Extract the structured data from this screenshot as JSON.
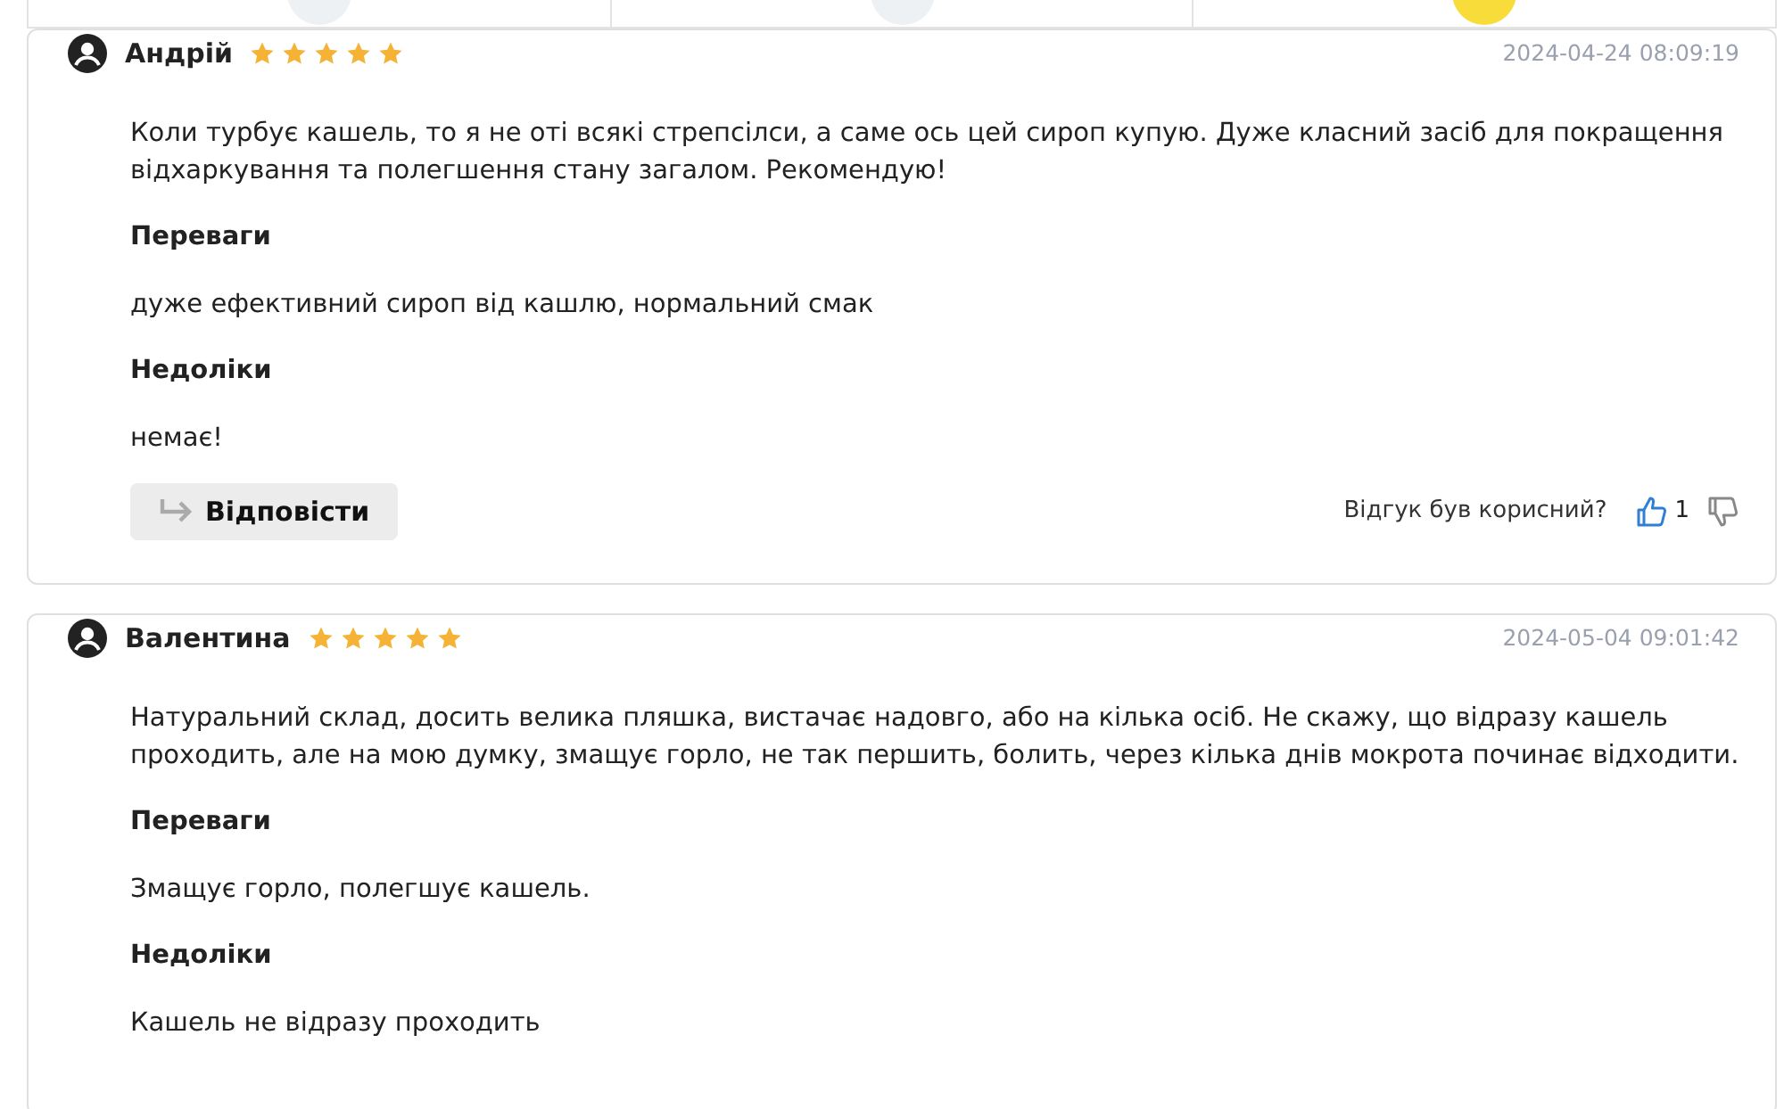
{
  "top_strip": {
    "cells": [
      {
        "kind": "picture-grey"
      },
      {
        "kind": "picture-grey"
      },
      {
        "kind": "picture-yellow"
      }
    ]
  },
  "reviews": [
    {
      "author": "Андрій",
      "stars": 5,
      "date": "2024-04-24 08:09:19",
      "text": "Коли турбує кашель, то я не оті всякі стрепсілси, а саме ось цей сироп купую. Дуже класний засіб для покращення відхаркування та полегшення стану загалом. Рекомендую!",
      "pros_label": "Переваги",
      "pros": "дуже ефективний сироп від кашлю, нормальний смак",
      "cons_label": "Недоліки",
      "cons": "немає!",
      "reply": "Відповісти",
      "helpful": "Відгук був корисний?",
      "likes": "1",
      "liked": true
    },
    {
      "author": "Валентина",
      "stars": 5,
      "date": "2024-05-04 09:01:42",
      "text": "Натуральний склад, досить велика пляшка, вистачає надовго, або на кілька осіб. Не скажу, що відразу кашель проходить, але на мою думку, змащує горло, не так першить, болить, через кілька днів мокрота починає відходити.",
      "pros_label": "Переваги",
      "pros": "Змащує горло, полегшує кашель.",
      "cons_label": "Недоліки",
      "cons": "Кашель не відразу проходить"
    }
  ]
}
